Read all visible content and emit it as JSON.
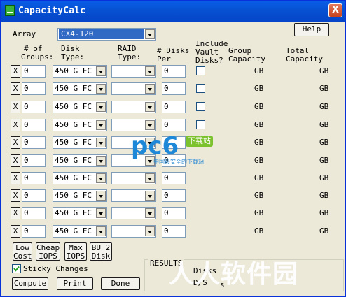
{
  "window": {
    "title": "CapacityCalc",
    "close_label": "X"
  },
  "top": {
    "array_label": "Array",
    "array_value": "CX4-120",
    "help_label": "Help"
  },
  "headers": {
    "groups": [
      "# of",
      "Groups:"
    ],
    "disk_type": [
      "Disk",
      "Type:"
    ],
    "raid_type": [
      "RAID",
      "Type:"
    ],
    "disks_per": [
      "# Disks",
      "Per"
    ],
    "include_vault": [
      "Include",
      "Vault",
      "Disks?"
    ],
    "group_capacity": [
      "Group",
      "Capacity"
    ],
    "total_capacity": [
      "Total",
      "Capacity"
    ]
  },
  "rows": [
    {
      "x": "X",
      "groups": "0",
      "disk_type": "450 G FC",
      "raid_type": "",
      "disks": "0",
      "has_vault": true,
      "group_cap": "GB",
      "total_cap": "GB"
    },
    {
      "x": "X",
      "groups": "0",
      "disk_type": "450 G FC",
      "raid_type": "",
      "disks": "0",
      "has_vault": true,
      "group_cap": "GB",
      "total_cap": "GB"
    },
    {
      "x": "X",
      "groups": "0",
      "disk_type": "450 G FC",
      "raid_type": "",
      "disks": "0",
      "has_vault": true,
      "group_cap": "GB",
      "total_cap": "GB"
    },
    {
      "x": "X",
      "groups": "0",
      "disk_type": "450 G FC",
      "raid_type": "",
      "disks": "0",
      "has_vault": true,
      "group_cap": "GB",
      "total_cap": "GB"
    },
    {
      "x": "X",
      "groups": "0",
      "disk_type": "450 G FC",
      "raid_type": "",
      "disks": "0",
      "has_vault": false,
      "group_cap": "GB",
      "total_cap": "GB"
    },
    {
      "x": "X",
      "groups": "0",
      "disk_type": "450 G FC",
      "raid_type": "",
      "disks": "0",
      "has_vault": false,
      "group_cap": "GB",
      "total_cap": "GB"
    },
    {
      "x": "X",
      "groups": "0",
      "disk_type": "450 G FC",
      "raid_type": "",
      "disks": "0",
      "has_vault": false,
      "group_cap": "GB",
      "total_cap": "GB"
    },
    {
      "x": "X",
      "groups": "0",
      "disk_type": "450 G FC",
      "raid_type": "",
      "disks": "0",
      "has_vault": false,
      "group_cap": "GB",
      "total_cap": "GB"
    },
    {
      "x": "X",
      "groups": "0",
      "disk_type": "450 G FC",
      "raid_type": "",
      "disks": "0",
      "has_vault": false,
      "group_cap": "GB",
      "total_cap": "GB"
    },
    {
      "x": "X",
      "groups": "0",
      "disk_type": "450 G FC",
      "raid_type": "",
      "disks": "0",
      "has_vault": false,
      "group_cap": "GB",
      "total_cap": "GB"
    }
  ],
  "presets": [
    [
      "Low",
      "Cost"
    ],
    [
      "Cheap",
      "IOPS"
    ],
    [
      "Max",
      "IOPS"
    ],
    [
      "BU 2",
      "Disk"
    ]
  ],
  "sticky_changes": {
    "label": "Sticky Changes",
    "checked": true
  },
  "actions": {
    "compute": "Compute",
    "print": "Print",
    "done": "Done"
  },
  "results": {
    "legend": "RESULTS",
    "disks_label": "Disks",
    "partial_label": "D/S",
    "partial_label2": "s"
  },
  "watermarks": {
    "pc6": "pc6",
    "pc6_badge": "下载站",
    "pc6_sub": "中国最安全的下载站",
    "big": "人人软件园"
  }
}
